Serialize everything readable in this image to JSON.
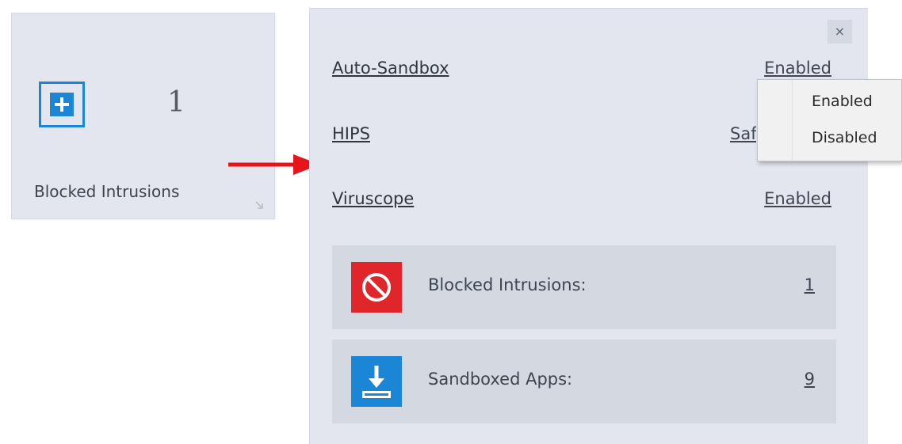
{
  "tile": {
    "icon": "plus-shield-icon",
    "count": "1",
    "label": "Blocked Intrusions",
    "expand_icon": "expand-arrow-icon"
  },
  "panel": {
    "close_label": "×",
    "settings": [
      {
        "label": "Auto-Sandbox",
        "value": "Enabled"
      },
      {
        "label": "HIPS",
        "value": "Safe Mode"
      },
      {
        "label": "Viruscope",
        "value": "Enabled"
      }
    ],
    "stats": [
      {
        "label": "Blocked Intrusions:",
        "value": "1",
        "icon": "blocked-icon",
        "icon_color": "#e0262b"
      },
      {
        "label": "Sandboxed Apps:",
        "value": "9",
        "icon": "download-icon",
        "icon_color": "#1b86d6"
      }
    ]
  },
  "dropdown": {
    "options": [
      "Enabled",
      "Disabled"
    ]
  },
  "colors": {
    "accent_blue": "#1b86d6",
    "alert_red": "#e0262b",
    "arrow_red": "#e8141b",
    "panel_bg": "#e3e6ee",
    "row_bg": "#d4d8e1"
  }
}
